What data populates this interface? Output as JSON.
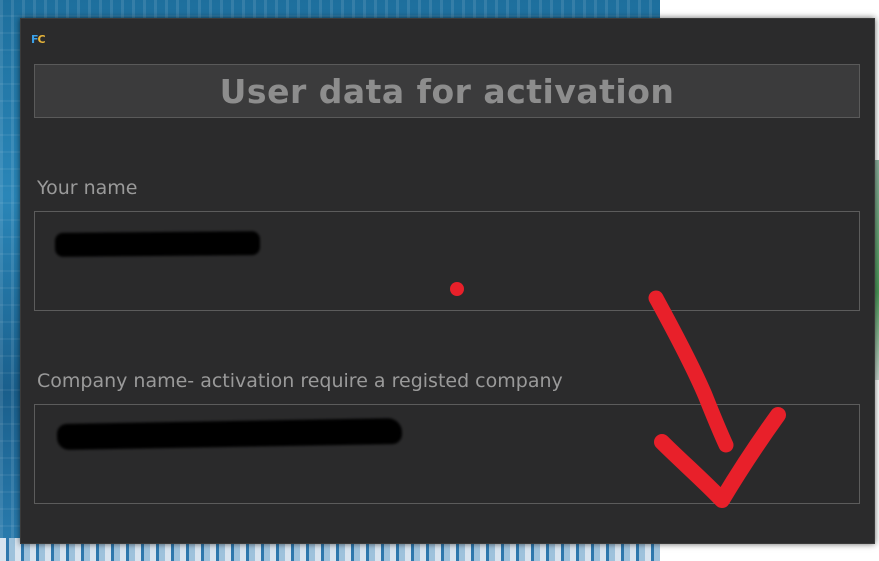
{
  "app": {
    "logo_part1": "F",
    "logo_part2": "C"
  },
  "dialog": {
    "title": "User data for activation",
    "name_field": {
      "label": "Your name",
      "value": ""
    },
    "company_field": {
      "label": "Company name- activation require a registed  company",
      "value": ""
    }
  },
  "colors": {
    "dialog_background": "#2b2b2c",
    "title_text": "#8d8d8d",
    "label_text": "#9a9a9a",
    "annotation": "#e8202a"
  },
  "icons": {
    "app_logo": "app-logo-icon",
    "annotation_mark": "red-checkmark-annotation"
  }
}
